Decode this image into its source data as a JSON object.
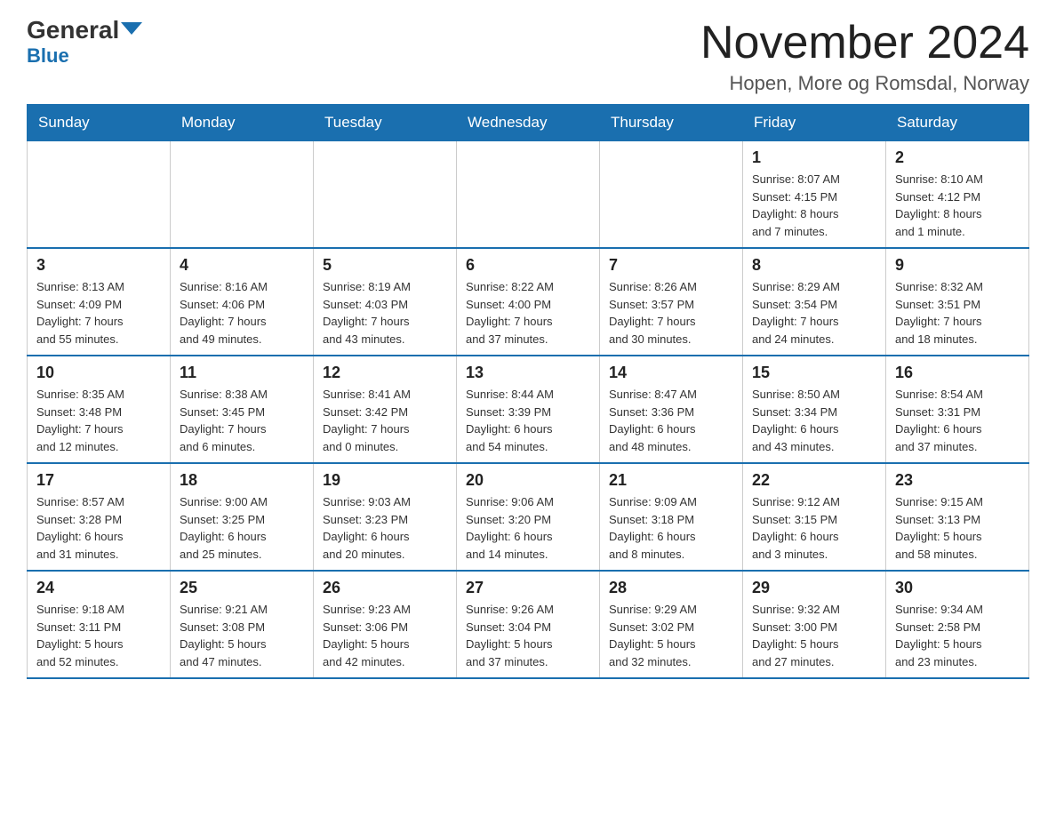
{
  "logo": {
    "general": "General",
    "blue": "Blue"
  },
  "header": {
    "month": "November 2024",
    "location": "Hopen, More og Romsdal, Norway"
  },
  "days_of_week": [
    "Sunday",
    "Monday",
    "Tuesday",
    "Wednesday",
    "Thursday",
    "Friday",
    "Saturday"
  ],
  "weeks": [
    [
      {
        "day": "",
        "info": ""
      },
      {
        "day": "",
        "info": ""
      },
      {
        "day": "",
        "info": ""
      },
      {
        "day": "",
        "info": ""
      },
      {
        "day": "",
        "info": ""
      },
      {
        "day": "1",
        "info": "Sunrise: 8:07 AM\nSunset: 4:15 PM\nDaylight: 8 hours\nand 7 minutes."
      },
      {
        "day": "2",
        "info": "Sunrise: 8:10 AM\nSunset: 4:12 PM\nDaylight: 8 hours\nand 1 minute."
      }
    ],
    [
      {
        "day": "3",
        "info": "Sunrise: 8:13 AM\nSunset: 4:09 PM\nDaylight: 7 hours\nand 55 minutes."
      },
      {
        "day": "4",
        "info": "Sunrise: 8:16 AM\nSunset: 4:06 PM\nDaylight: 7 hours\nand 49 minutes."
      },
      {
        "day": "5",
        "info": "Sunrise: 8:19 AM\nSunset: 4:03 PM\nDaylight: 7 hours\nand 43 minutes."
      },
      {
        "day": "6",
        "info": "Sunrise: 8:22 AM\nSunset: 4:00 PM\nDaylight: 7 hours\nand 37 minutes."
      },
      {
        "day": "7",
        "info": "Sunrise: 8:26 AM\nSunset: 3:57 PM\nDaylight: 7 hours\nand 30 minutes."
      },
      {
        "day": "8",
        "info": "Sunrise: 8:29 AM\nSunset: 3:54 PM\nDaylight: 7 hours\nand 24 minutes."
      },
      {
        "day": "9",
        "info": "Sunrise: 8:32 AM\nSunset: 3:51 PM\nDaylight: 7 hours\nand 18 minutes."
      }
    ],
    [
      {
        "day": "10",
        "info": "Sunrise: 8:35 AM\nSunset: 3:48 PM\nDaylight: 7 hours\nand 12 minutes."
      },
      {
        "day": "11",
        "info": "Sunrise: 8:38 AM\nSunset: 3:45 PM\nDaylight: 7 hours\nand 6 minutes."
      },
      {
        "day": "12",
        "info": "Sunrise: 8:41 AM\nSunset: 3:42 PM\nDaylight: 7 hours\nand 0 minutes."
      },
      {
        "day": "13",
        "info": "Sunrise: 8:44 AM\nSunset: 3:39 PM\nDaylight: 6 hours\nand 54 minutes."
      },
      {
        "day": "14",
        "info": "Sunrise: 8:47 AM\nSunset: 3:36 PM\nDaylight: 6 hours\nand 48 minutes."
      },
      {
        "day": "15",
        "info": "Sunrise: 8:50 AM\nSunset: 3:34 PM\nDaylight: 6 hours\nand 43 minutes."
      },
      {
        "day": "16",
        "info": "Sunrise: 8:54 AM\nSunset: 3:31 PM\nDaylight: 6 hours\nand 37 minutes."
      }
    ],
    [
      {
        "day": "17",
        "info": "Sunrise: 8:57 AM\nSunset: 3:28 PM\nDaylight: 6 hours\nand 31 minutes."
      },
      {
        "day": "18",
        "info": "Sunrise: 9:00 AM\nSunset: 3:25 PM\nDaylight: 6 hours\nand 25 minutes."
      },
      {
        "day": "19",
        "info": "Sunrise: 9:03 AM\nSunset: 3:23 PM\nDaylight: 6 hours\nand 20 minutes."
      },
      {
        "day": "20",
        "info": "Sunrise: 9:06 AM\nSunset: 3:20 PM\nDaylight: 6 hours\nand 14 minutes."
      },
      {
        "day": "21",
        "info": "Sunrise: 9:09 AM\nSunset: 3:18 PM\nDaylight: 6 hours\nand 8 minutes."
      },
      {
        "day": "22",
        "info": "Sunrise: 9:12 AM\nSunset: 3:15 PM\nDaylight: 6 hours\nand 3 minutes."
      },
      {
        "day": "23",
        "info": "Sunrise: 9:15 AM\nSunset: 3:13 PM\nDaylight: 5 hours\nand 58 minutes."
      }
    ],
    [
      {
        "day": "24",
        "info": "Sunrise: 9:18 AM\nSunset: 3:11 PM\nDaylight: 5 hours\nand 52 minutes."
      },
      {
        "day": "25",
        "info": "Sunrise: 9:21 AM\nSunset: 3:08 PM\nDaylight: 5 hours\nand 47 minutes."
      },
      {
        "day": "26",
        "info": "Sunrise: 9:23 AM\nSunset: 3:06 PM\nDaylight: 5 hours\nand 42 minutes."
      },
      {
        "day": "27",
        "info": "Sunrise: 9:26 AM\nSunset: 3:04 PM\nDaylight: 5 hours\nand 37 minutes."
      },
      {
        "day": "28",
        "info": "Sunrise: 9:29 AM\nSunset: 3:02 PM\nDaylight: 5 hours\nand 32 minutes."
      },
      {
        "day": "29",
        "info": "Sunrise: 9:32 AM\nSunset: 3:00 PM\nDaylight: 5 hours\nand 27 minutes."
      },
      {
        "day": "30",
        "info": "Sunrise: 9:34 AM\nSunset: 2:58 PM\nDaylight: 5 hours\nand 23 minutes."
      }
    ]
  ]
}
